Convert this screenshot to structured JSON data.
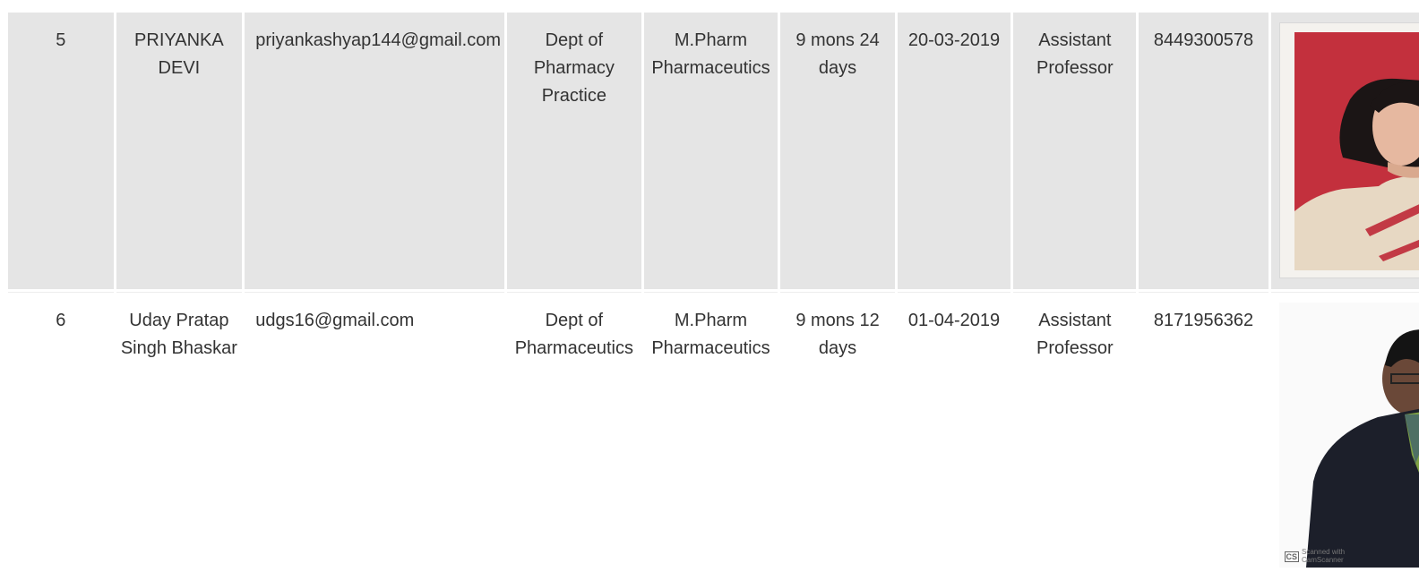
{
  "rows": [
    {
      "sno": "5",
      "name": "PRIYANKA DEVI",
      "email": "priyankashyap144@gmail.com",
      "department": "Dept of Pharmacy Practice",
      "qualification": "M.Pharm Pharmaceutics",
      "experience": "9 mons 24 days",
      "joining_date": "20-03-2019",
      "designation": "Assistant Professor",
      "phone": "8449300578"
    },
    {
      "sno": "6",
      "name": "Uday Pratap Singh Bhaskar",
      "email": "udgs16@gmail.com",
      "department": "Dept of Pharmaceutics",
      "qualification": "M.Pharm Pharmaceutics",
      "experience": "9 mons 12 days",
      "joining_date": "01-04-2019",
      "designation": "Assistant Professor",
      "phone": "8171956362",
      "photo_watermark": {
        "logo": "CS",
        "line1": "Scanned with",
        "line2": "CamScanner"
      }
    }
  ],
  "colors": {
    "row_alt_bg": "#e5e5e5",
    "text": "#333333"
  }
}
